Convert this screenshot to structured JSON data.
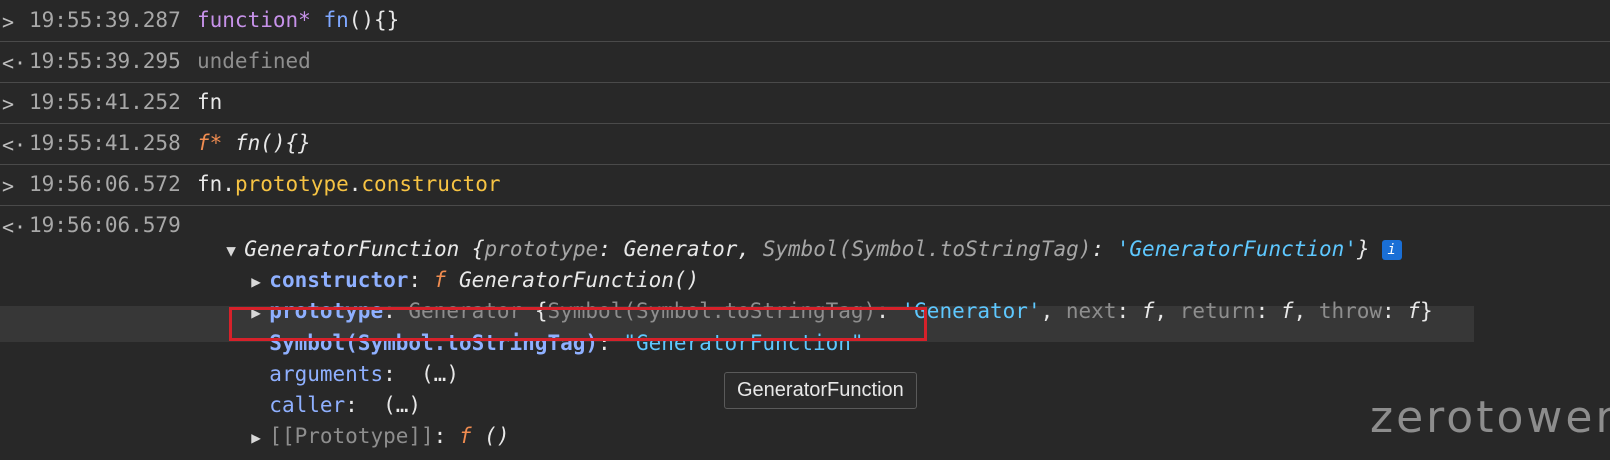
{
  "rows": [
    {
      "ts": "19:55:39.287",
      "arrow": ">",
      "kw": "function*",
      "name": "fn",
      "rest": "(){}"
    },
    {
      "ts": "19:55:39.295",
      "arrow": "<·",
      "text": "undefined"
    },
    {
      "ts": "19:55:41.252",
      "arrow": ">",
      "text": "fn"
    },
    {
      "ts": "19:55:41.258",
      "arrow": "<·",
      "f": "f*",
      "text": " fn(){}"
    },
    {
      "ts": "19:56:06.572",
      "arrow": ">",
      "obj": "fn",
      "p1": "prototype",
      "p2": "constructor"
    },
    {
      "ts": "19:56:06.579",
      "arrow": "<·"
    }
  ],
  "result": {
    "head_name": "GeneratorFunction",
    "head_brace_open": " {",
    "head_k1": "prototype",
    "head_v1": "Generator",
    "head_k2": "Symbol(Symbol.toStringTag)",
    "head_v2": "'GeneratorFunction'",
    "head_brace_close": "}",
    "info_badge": "i",
    "children": {
      "constructor_key": "constructor",
      "constructor_f": "f",
      "constructor_val": "GeneratorFunction()",
      "prototype_key": "prototype",
      "prototype_val_name": "Generator",
      "prototype_inner_k1": "Symbol(Symbol.toStringTag)",
      "prototype_inner_v1": "'Generator'",
      "prototype_inner_k2": "next",
      "prototype_inner_k3": "return",
      "prototype_inner_k4": "throw",
      "prototype_inner_f": "f",
      "symbol_key": "Symbol(Symbol.toStringTag)",
      "symbol_val": "\"GeneratorFunction\"",
      "arguments_key": "arguments",
      "arguments_val": "(…)",
      "caller_key": "caller",
      "caller_val": "(…)",
      "proto_key": "[[Prototype]]",
      "proto_f": "f",
      "proto_val": "()"
    }
  },
  "tooltip": "GeneratorFunction",
  "watermark": "zerotower"
}
